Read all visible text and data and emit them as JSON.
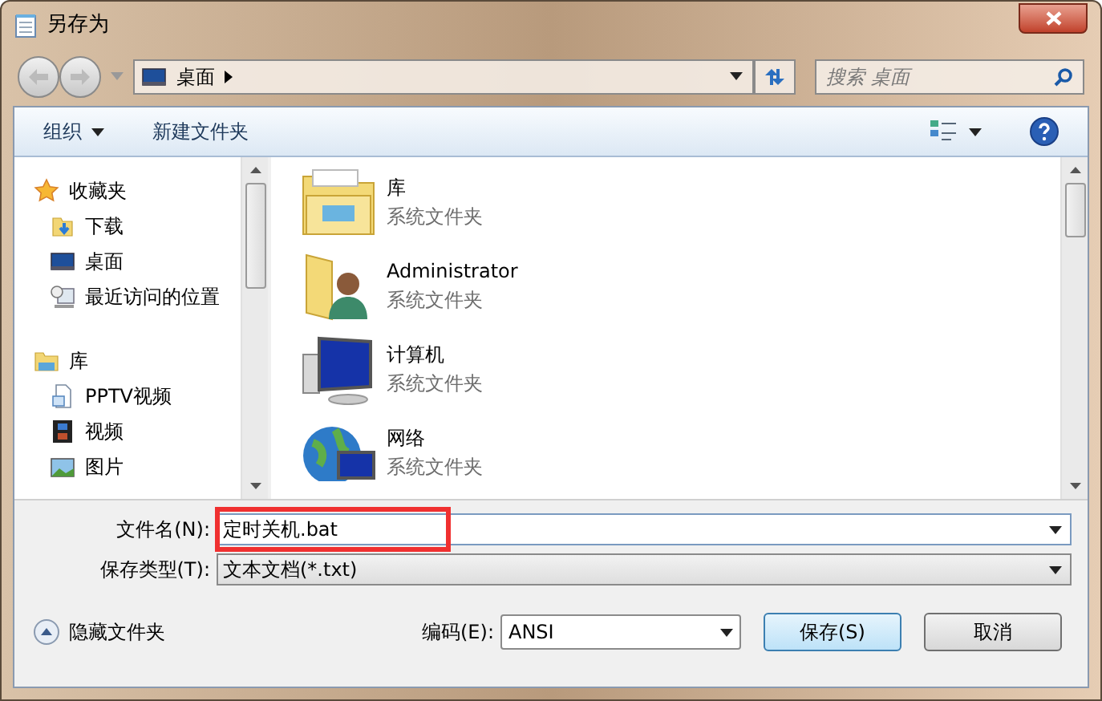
{
  "window": {
    "title": "另存为"
  },
  "nav": {
    "path": "桌面",
    "search_placeholder": "搜索 桌面"
  },
  "toolbar": {
    "organize": "组织",
    "new_folder": "新建文件夹"
  },
  "sidebar": [
    {
      "label": "收藏夹",
      "kind": "favorites",
      "items": [
        {
          "label": "下载",
          "kind": "download"
        },
        {
          "label": "桌面",
          "kind": "desktop"
        },
        {
          "label": "最近访问的位置",
          "kind": "recent"
        }
      ]
    },
    {
      "label": "库",
      "kind": "library",
      "items": [
        {
          "label": "PPTV视频",
          "kind": "document"
        },
        {
          "label": "视频",
          "kind": "video"
        },
        {
          "label": "图片",
          "kind": "picture"
        }
      ]
    }
  ],
  "files": [
    {
      "name": "库",
      "type": "系统文件夹",
      "kind": "library"
    },
    {
      "name": "Administrator",
      "type": "系统文件夹",
      "kind": "user"
    },
    {
      "name": "计算机",
      "type": "系统文件夹",
      "kind": "computer"
    },
    {
      "name": "网络",
      "type": "系统文件夹",
      "kind": "network"
    }
  ],
  "form": {
    "filename_label": "文件名(N):",
    "filename": "定时关机.bat",
    "filetype_label": "保存类型(T):",
    "filetype": "文本文档(*.txt)"
  },
  "footer": {
    "hide_folders": "隐藏文件夹",
    "encoding_label": "编码(E):",
    "encoding": "ANSI"
  },
  "buttons": [
    {
      "label": "保存(S)",
      "default": true
    },
    {
      "label": "取消",
      "default": false
    }
  ]
}
